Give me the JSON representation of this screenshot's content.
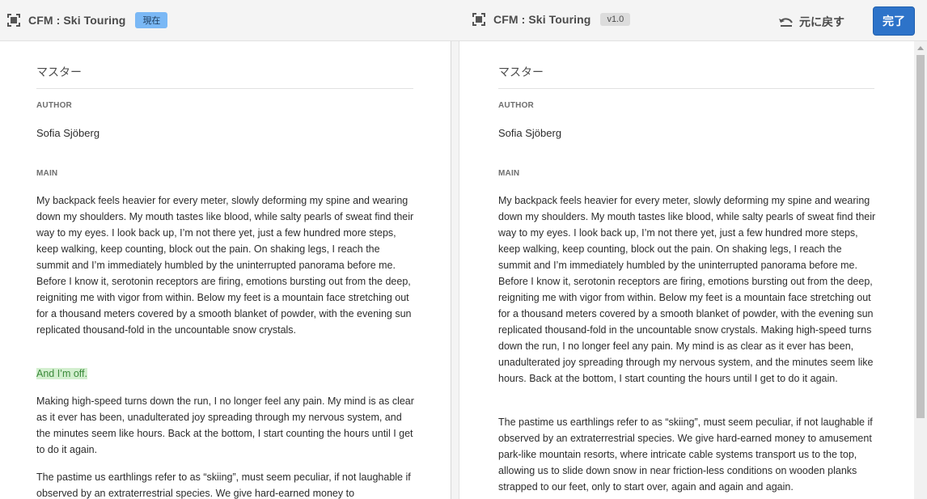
{
  "header": {
    "left_title": "CFM : Ski Touring",
    "left_badge": "現在",
    "right_title": "CFM : Ski Touring",
    "right_badge": "v1.0",
    "revert_label": "元に戻す",
    "done_label": "完了"
  },
  "left": {
    "section": "マスター",
    "author_label": "AUTHOR",
    "author": "Sofia Sjöberg",
    "main_label": "MAIN",
    "paragraphs": [
      "My backpack feels heavier for every meter, slowly deforming my spine and wearing down my shoulders. My mouth tastes like blood, while salty pearls of sweat find their way to my eyes. I look back up, I’m not there yet, just a few hundred more steps, keep walking, keep counting, block out the pain. On shaking legs, I reach the summit and I’m immediately humbled by the uninterrupted panorama before me. Before I know it, serotonin receptors are firing, emotions bursting out from the deep, reigniting me with vigor from within. Below my feet is a mountain face stretching out for a thousand meters covered by a smooth blanket of powder, with the evening sun replicated thousand-fold in the uncountable snow crystals.",
      "And I’m off.",
      "Making high-speed turns down the run, I no longer feel any pain. My mind is as clear as it ever has been, unadulterated joy spreading through my nervous system, and the minutes seem like hours. Back at the bottom, I start counting the hours until I get to do it again.",
      "The pastime us earthlings refer to as “skiing”, must seem peculiar, if not laughable if observed by an extraterrestrial species. We give hard-earned money to"
    ]
  },
  "right": {
    "section": "マスター",
    "author_label": "AUTHOR",
    "author": "Sofia Sjöberg",
    "main_label": "MAIN",
    "paragraphs": [
      "My backpack feels heavier for every meter, slowly deforming my spine and wearing down my shoulders. My mouth tastes like blood, while salty pearls of sweat find their way to my eyes. I look back up, I’m not there yet, just a few hundred more steps, keep walking, keep counting, block out the pain. On shaking legs, I reach the summit and I’m immediately humbled by the uninterrupted panorama before me. Before I know it, serotonin receptors are firing, emotions bursting out from the deep, reigniting me with vigor from within. Below my feet is a mountain face stretching out for a thousand meters covered by a smooth blanket of powder, with the evening sun replicated thousand-fold in the uncountable snow crystals. Making high-speed turns down the run, I no longer feel any pain. My mind is as clear as it ever has been, unadulterated joy spreading through my nervous system, and the minutes seem like hours. Back at the bottom, I start counting the hours until I get to do it again.",
      "The pastime us earthlings refer to as “skiing”, must seem peculiar, if not laughable if observed by an extraterrestrial species. We give hard-earned money to amusement park-like mountain resorts, where intricate cable systems transport us to the top, allowing us to slide down snow in near friction-less conditions on wooden planks strapped to our feet, only to start over, again and again and again."
    ]
  },
  "colors": {
    "accent": "#2d73c9",
    "current_badge": "#7ab8f5",
    "highlight_bg": "#d3efcf",
    "highlight_text": "#3a8a3a"
  }
}
